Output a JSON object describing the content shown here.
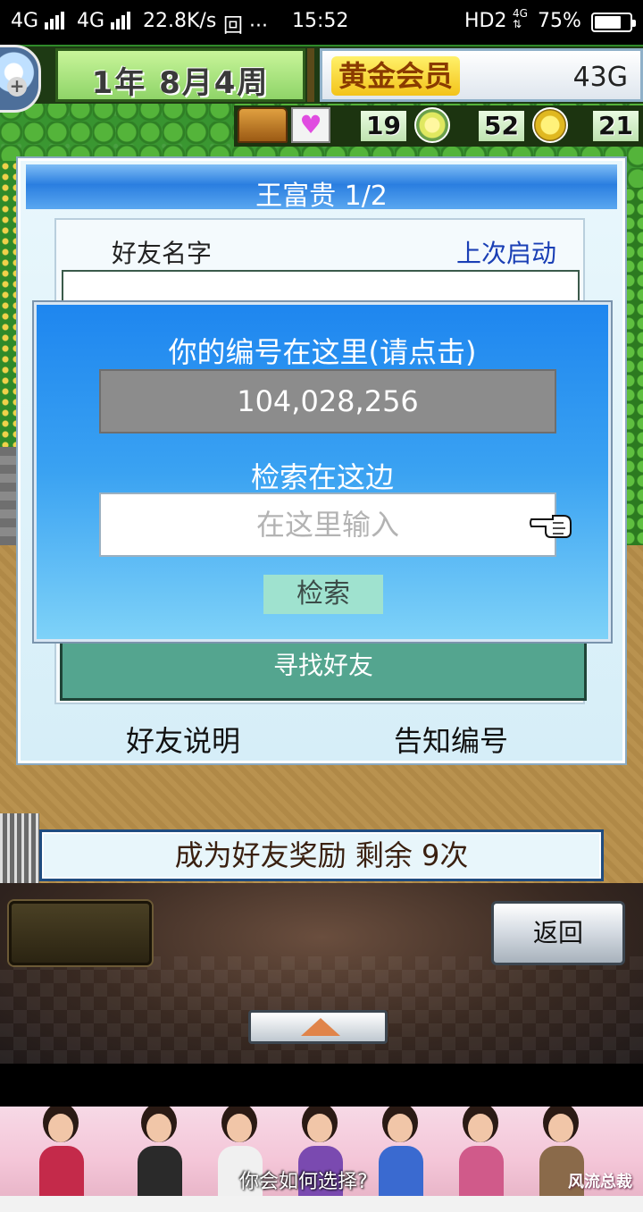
{
  "status_bar": {
    "network1": "4G",
    "network2": "4G",
    "speed": "22.8K/s",
    "extra": "回 ···",
    "time": "15:52",
    "hd": "HD2",
    "battery_percent": "75%",
    "battery_level": 0.75
  },
  "game_hud": {
    "date": "1年 8月4周",
    "vip_label": "黄金会员",
    "gold": "43G",
    "resource_1": "19",
    "resource_2": "52",
    "resource_3": "21"
  },
  "friends_panel": {
    "title": "王富贵 1/2",
    "col_friend_name": "好友名字",
    "col_last_launch": "上次启动",
    "find_friend_button": "寻找好友",
    "friend_help_link": "好友说明",
    "tell_id_link": "告知编号"
  },
  "id_dialog": {
    "title": "你的编号在这里(请点击)",
    "player_id": "104,028,256",
    "search_label": "检索在这边",
    "search_placeholder": "在这里输入",
    "search_button": "检索"
  },
  "reward_bar": {
    "text": "成为好友奖励 剩余 9次"
  },
  "bottom_controls": {
    "back_button": "返回"
  },
  "ad_banner": {
    "caption": "你会如何选择?",
    "logo": "风流总裁",
    "accent_colors": [
      "#c42a4a",
      "#2a2a2a",
      "#f0f0f0",
      "#7a4ab0",
      "#3a6ad0",
      "#d05a8a",
      "#8a6a4a"
    ]
  }
}
